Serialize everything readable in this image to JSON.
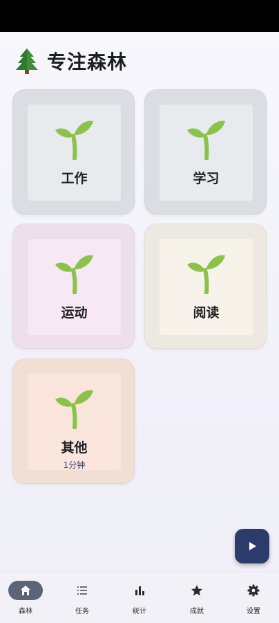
{
  "header": {
    "icon": "evergreen-tree-icon",
    "title": "专注森林"
  },
  "categories": [
    {
      "label": "工作",
      "sub": "",
      "icon": "sprout-icon",
      "color": "#dadde2"
    },
    {
      "label": "学习",
      "sub": "",
      "icon": "sprout-icon",
      "color": "#dadde2"
    },
    {
      "label": "运动",
      "sub": "",
      "icon": "sprout-icon",
      "color": "#ede0ec"
    },
    {
      "label": "阅读",
      "sub": "",
      "icon": "sprout-icon",
      "color": "#ede9e1"
    },
    {
      "label": "其他",
      "sub": "1分钟",
      "icon": "sprout-icon",
      "color": "#f1dfd4"
    }
  ],
  "fab": {
    "icon": "play-icon",
    "color": "#2b3c6c"
  },
  "nav": {
    "items": [
      {
        "label": "森林",
        "icon": "home-icon",
        "active": true
      },
      {
        "label": "任务",
        "icon": "list-icon",
        "active": false
      },
      {
        "label": "统计",
        "icon": "bar-chart-icon",
        "active": false
      },
      {
        "label": "成就",
        "icon": "star-icon",
        "active": false
      },
      {
        "label": "设置",
        "icon": "gear-icon",
        "active": false
      }
    ]
  },
  "colors": {
    "accent": "#2b3c6c",
    "nav_active": "#5d6378",
    "sprout": "#8bc34a"
  }
}
